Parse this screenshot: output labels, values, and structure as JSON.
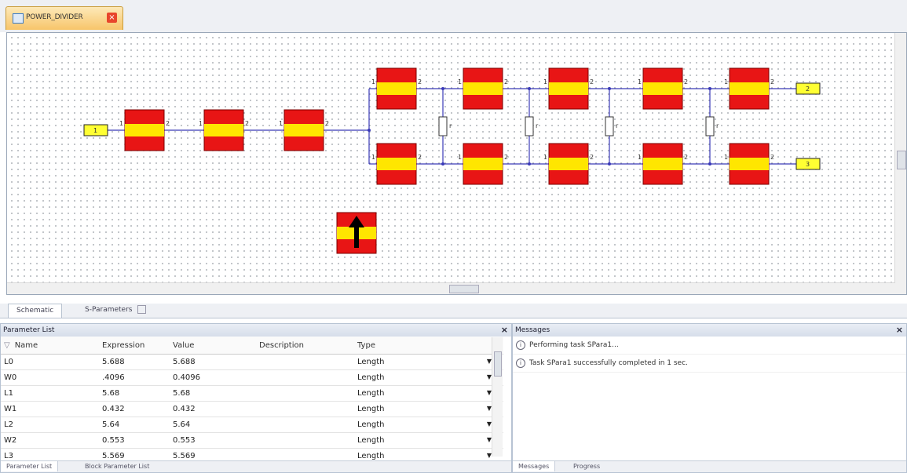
{
  "doc_tab": {
    "label": "POWER_DIVIDER",
    "close": "×"
  },
  "schematic": {
    "port_in": "1",
    "port_out_top": "2",
    "port_out_bottom": "3",
    "pin_left": "1",
    "pin_right": "2",
    "resistor_label": "r"
  },
  "bottom_tabs": [
    "Schematic",
    "S-Parameters"
  ],
  "parameter_list": {
    "title": "Parameter List",
    "columns": [
      "Name",
      "Expression",
      "Value",
      "Description",
      "Type"
    ],
    "rows": [
      {
        "name": "L0",
        "expr": "5.688",
        "value": "5.688",
        "desc": "",
        "type": "Length"
      },
      {
        "name": "W0",
        "expr": ".4096",
        "value": "0.4096",
        "desc": "",
        "type": "Length"
      },
      {
        "name": "L1",
        "expr": "5.68",
        "value": "5.68",
        "desc": "",
        "type": "Length"
      },
      {
        "name": "W1",
        "expr": "0.432",
        "value": "0.432",
        "desc": "",
        "type": "Length"
      },
      {
        "name": "L2",
        "expr": "5.64",
        "value": "5.64",
        "desc": "",
        "type": "Length"
      },
      {
        "name": "W2",
        "expr": "0.553",
        "value": "0.553",
        "desc": "",
        "type": "Length"
      },
      {
        "name": "L3",
        "expr": "5.569",
        "value": "5.569",
        "desc": "",
        "type": "Length"
      }
    ],
    "footer_tabs": [
      "Parameter List",
      "Block Parameter List"
    ]
  },
  "messages": {
    "title": "Messages",
    "items": [
      "Performing task SPara1...",
      "Task SPara1 successfully completed in 1 sec."
    ],
    "footer_tabs": [
      "Messages",
      "Progress"
    ]
  },
  "colors": {
    "block_red": "#e81515",
    "block_yellow": "#ffe600",
    "wire": "#3a3ab8",
    "port_fill": "#ffff33"
  }
}
